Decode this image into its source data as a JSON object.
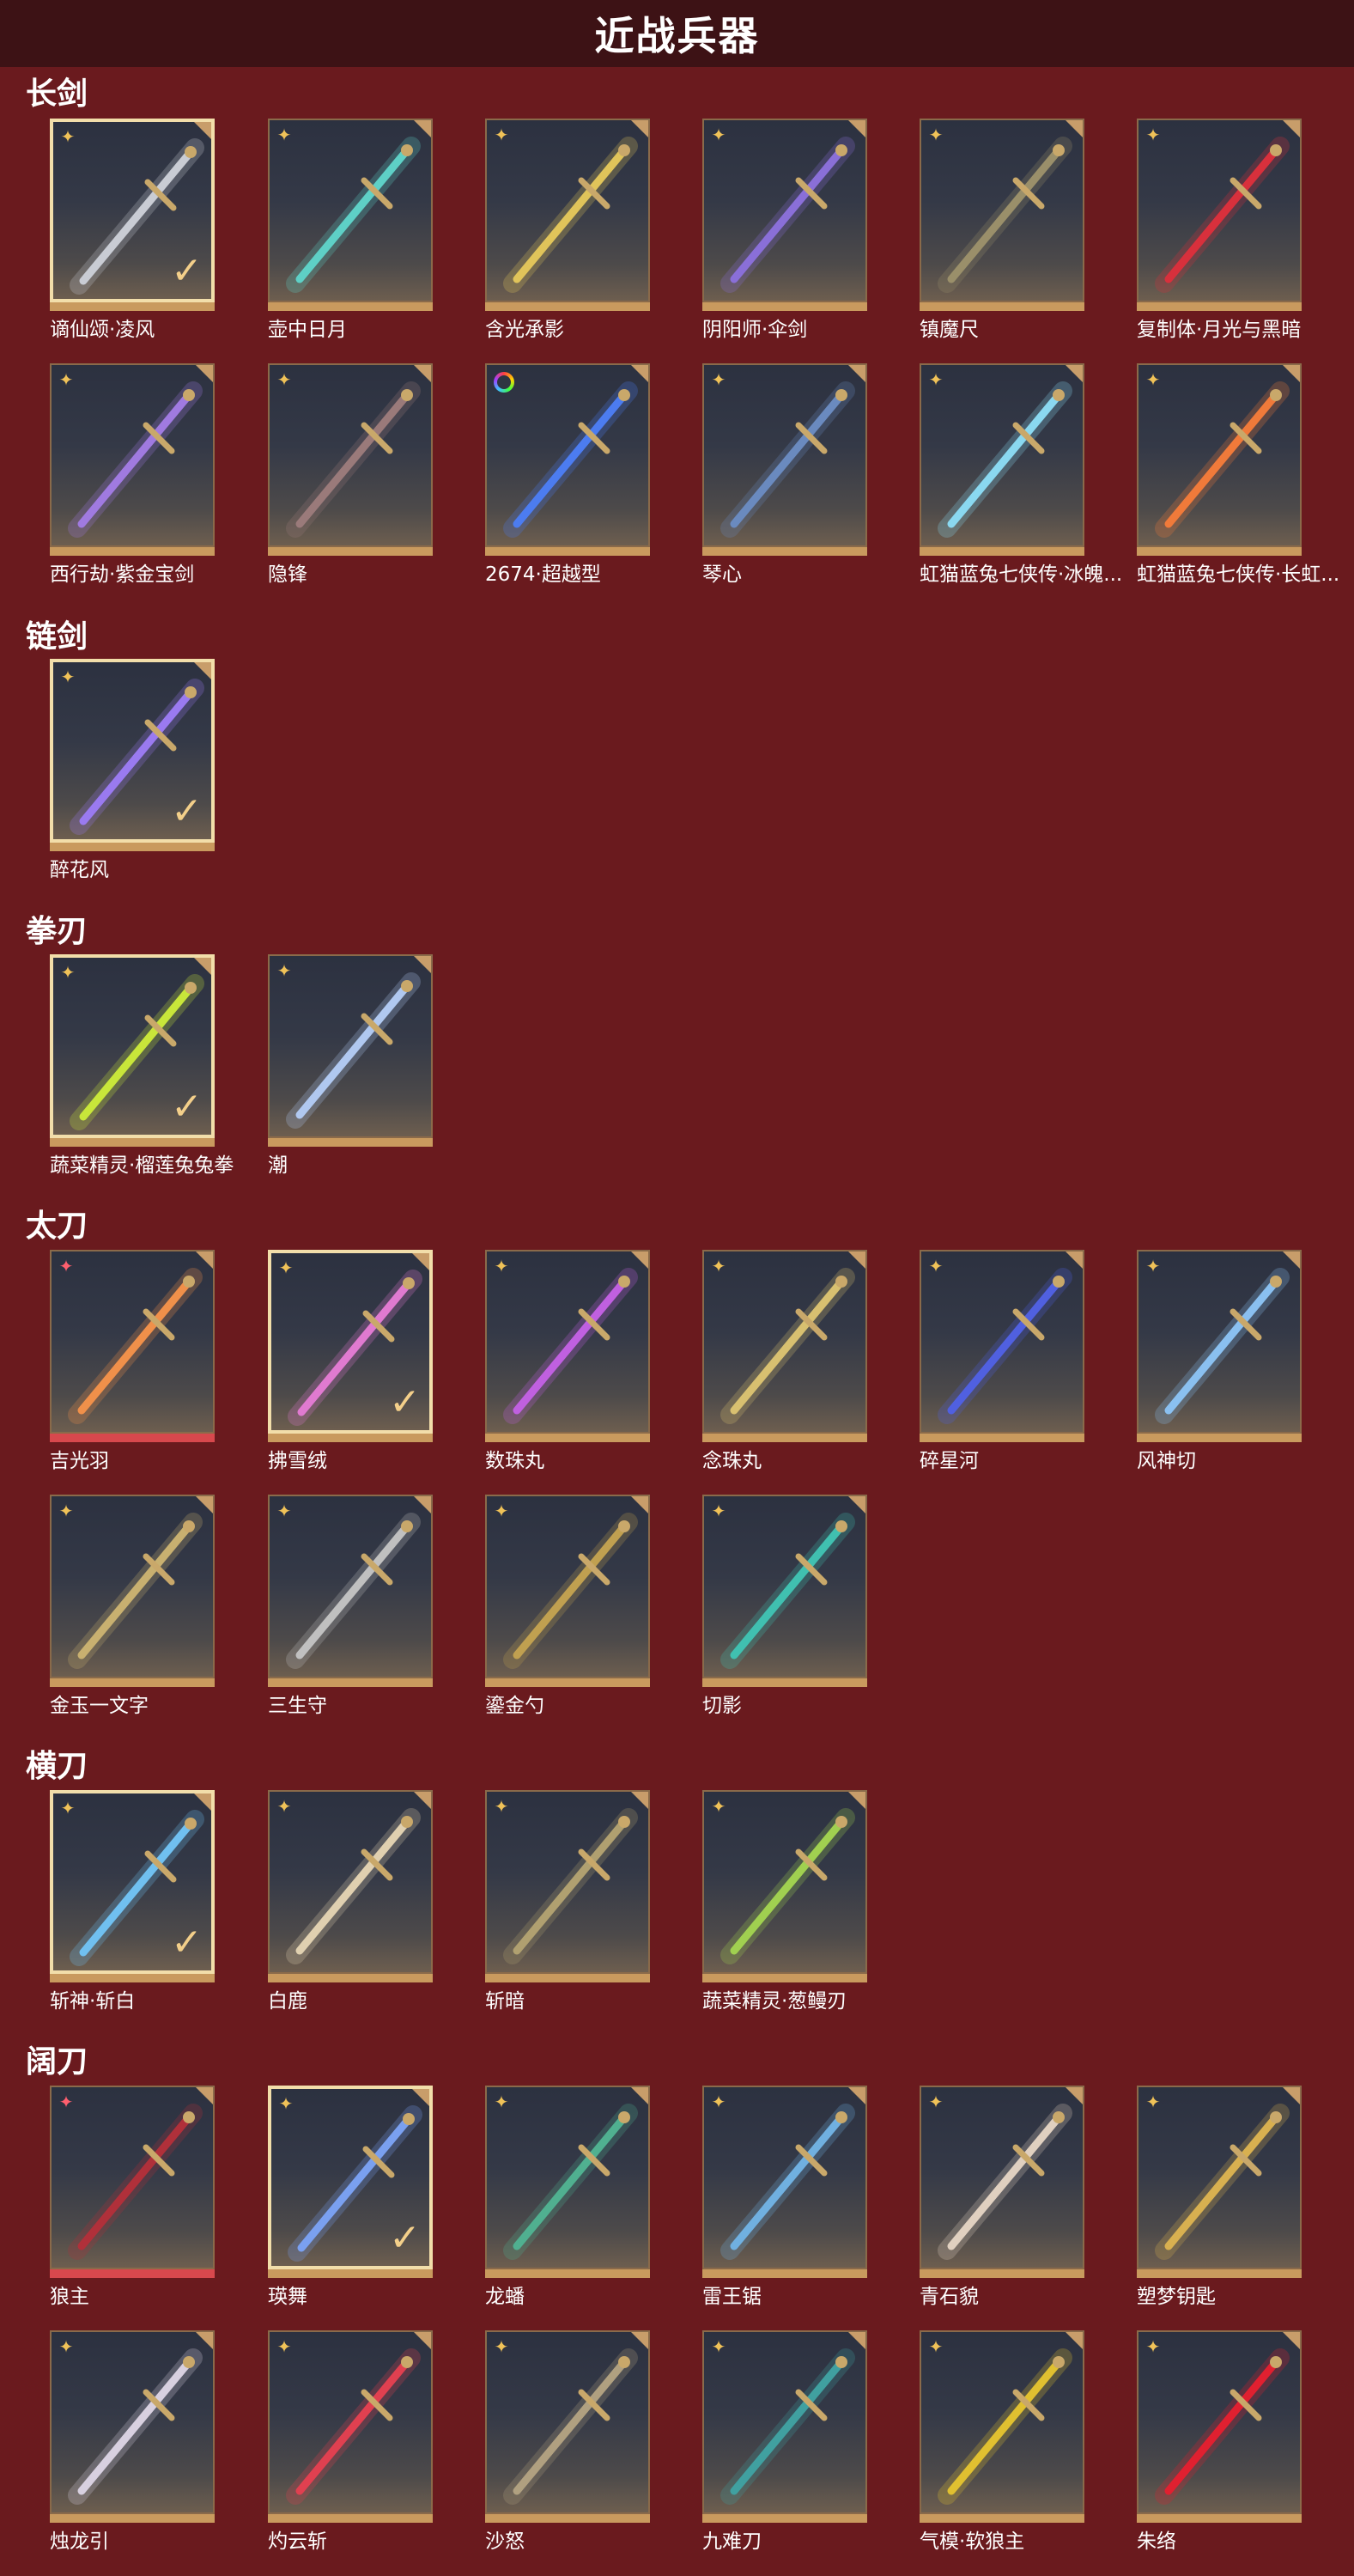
{
  "header": {
    "title": "近战兵器"
  },
  "colors": {
    "background": "#6a1a1e",
    "header": "#3d1215",
    "gold_badge": "#f0c258",
    "rare_badge": "#ff5f6e",
    "check": "#f3cf8a"
  },
  "categories": [
    {
      "title": "长剑",
      "items": [
        {
          "label": "谪仙颂·凌风",
          "selected": true,
          "badge": "star-icon",
          "color": "#c9ccd4"
        },
        {
          "label": "壶中日月",
          "badge": "star-icon",
          "color": "#5ed0c6"
        },
        {
          "label": "含光承影",
          "badge": "star-icon",
          "color": "#e0c45a"
        },
        {
          "label": "阴阳师·伞剑",
          "badge": "star-icon",
          "color": "#8a6fd8"
        },
        {
          "label": "镇魔尺",
          "badge": "star-icon",
          "color": "#9a8f6a"
        },
        {
          "label": "复制体·月光与黑暗",
          "badge": "star-icon",
          "color": "#d8303c"
        },
        {
          "label": "西行劫·紫金宝剑",
          "badge": "star-icon",
          "color": "#a07ae0"
        },
        {
          "label": "隐锋",
          "badge": "star-icon",
          "color": "#9a7a7a"
        },
        {
          "label": "2674·超越型",
          "badge": "ring-icon",
          "color": "#4c7cf0"
        },
        {
          "label": "琴心",
          "badge": "star-icon",
          "color": "#6a8abf"
        },
        {
          "label": "虹猫蓝兔七侠传·冰魄...",
          "badge": "star-icon",
          "color": "#8ad8f0"
        },
        {
          "label": "虹猫蓝兔七侠传·长虹...",
          "badge": "star-icon",
          "color": "#f07a3a"
        }
      ]
    },
    {
      "title": "链剑",
      "items": [
        {
          "label": "醉花风",
          "selected": true,
          "badge": "star-icon",
          "color": "#9a7af0"
        }
      ]
    },
    {
      "title": "拳刃",
      "items": [
        {
          "label": "蔬菜精灵·榴莲兔兔拳",
          "selected": true,
          "badge": "star-icon",
          "color": "#c8e63a"
        },
        {
          "label": "潮",
          "badge": "star-icon",
          "color": "#b0c8f0"
        }
      ]
    },
    {
      "title": "太刀",
      "items": [
        {
          "label": "吉光羽",
          "rare": true,
          "badge": "rare-star-icon",
          "color": "#f0904a"
        },
        {
          "label": "拂雪绒",
          "selected": true,
          "badge": "star-icon",
          "color": "#e07ad0"
        },
        {
          "label": "数珠丸",
          "badge": "star-icon",
          "color": "#c060e0"
        },
        {
          "label": "念珠丸",
          "badge": "star-icon",
          "color": "#d8c070"
        },
        {
          "label": "碎星河",
          "badge": "star-icon",
          "color": "#5060e0"
        },
        {
          "label": "风神切",
          "badge": "star-icon",
          "color": "#8ac0f0"
        },
        {
          "label": "金玉一文字",
          "badge": "star-icon",
          "color": "#c8b070"
        },
        {
          "label": "三生守",
          "badge": "star-icon",
          "color": "#c0c0c0"
        },
        {
          "label": "鎏金勺",
          "badge": "star-icon",
          "color": "#c0a050"
        },
        {
          "label": "切影",
          "badge": "star-icon",
          "color": "#40c0b0"
        }
      ]
    },
    {
      "title": "横刀",
      "items": [
        {
          "label": "斩神·斩白",
          "selected": true,
          "badge": "star-icon",
          "color": "#70c0f0"
        },
        {
          "label": "白鹿",
          "badge": "star-icon",
          "color": "#e0d0b0"
        },
        {
          "label": "斩暗",
          "badge": "star-icon",
          "color": "#b0a070"
        },
        {
          "label": "蔬菜精灵·葱鳗刃",
          "badge": "star-icon",
          "color": "#a0d050"
        }
      ]
    },
    {
      "title": "阔刀",
      "items": [
        {
          "label": "狼主",
          "rare": true,
          "badge": "rare-star-icon",
          "color": "#b0303a"
        },
        {
          "label": "瑛舞",
          "selected": true,
          "badge": "star-icon",
          "color": "#7aa0f0"
        },
        {
          "label": "龙蟠",
          "badge": "star-icon",
          "color": "#50b090"
        },
        {
          "label": "雷王锯",
          "badge": "star-icon",
          "color": "#70b0e0"
        },
        {
          "label": "青石貌",
          "badge": "star-icon",
          "color": "#e0d0c0"
        },
        {
          "label": "塑梦钥匙",
          "badge": "star-icon",
          "color": "#d8b050"
        },
        {
          "label": "烛龙引",
          "badge": "star-icon",
          "color": "#d8d0e0"
        },
        {
          "label": "灼云斩",
          "badge": "star-icon",
          "color": "#e04050"
        },
        {
          "label": "沙怒",
          "badge": "star-icon",
          "color": "#b0a080"
        },
        {
          "label": "九难刀",
          "badge": "star-icon",
          "color": "#40a0a0"
        },
        {
          "label": "气模·软狼主",
          "badge": "star-icon",
          "color": "#e0c030"
        },
        {
          "label": "朱络",
          "badge": "star-icon",
          "color": "#e02030"
        }
      ]
    }
  ]
}
